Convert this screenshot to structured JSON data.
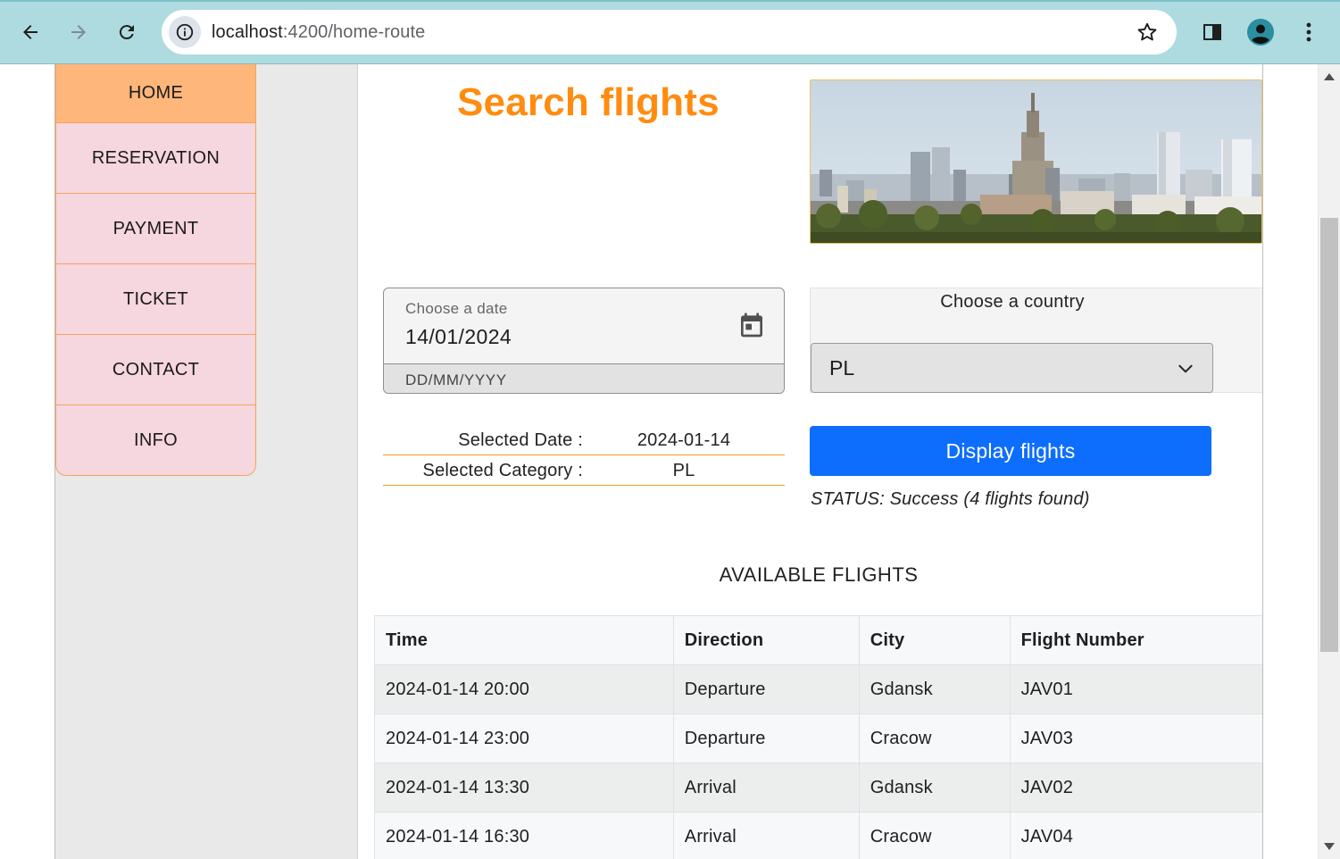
{
  "browser": {
    "url_host": "localhost",
    "url_path": ":4200/home-route"
  },
  "nav": {
    "items": [
      {
        "label": "HOME"
      },
      {
        "label": "RESERVATION"
      },
      {
        "label": "PAYMENT"
      },
      {
        "label": "TICKET"
      },
      {
        "label": "CONTACT"
      },
      {
        "label": "INFO"
      }
    ]
  },
  "page": {
    "title": "Search flights",
    "accent_color": "#ff8c10"
  },
  "date_field": {
    "label": "Choose a date",
    "value": "14/01/2024",
    "hint": "DD/MM/YYYY"
  },
  "country": {
    "label": "Choose a country",
    "selected": "PL"
  },
  "summary": {
    "date_label": "Selected Date :",
    "date_value": "2024-01-14",
    "category_label": "Selected Category :",
    "category_value": "PL"
  },
  "actions": {
    "display_label": "Display flights",
    "button_color": "#0d6efd"
  },
  "status": {
    "text": "STATUS: Success (4 flights found)"
  },
  "flights": {
    "heading": "AVAILABLE FLIGHTS",
    "columns": [
      "Time",
      "Direction",
      "City",
      "Flight Number"
    ],
    "rows": [
      [
        "2024-01-14 20:00",
        "Departure",
        "Gdansk",
        "JAV01"
      ],
      [
        "2024-01-14 23:00",
        "Departure",
        "Cracow",
        "JAV03"
      ],
      [
        "2024-01-14 13:30",
        "Arrival",
        "Gdansk",
        "JAV02"
      ],
      [
        "2024-01-14 16:30",
        "Arrival",
        "Cracow",
        "JAV04"
      ]
    ]
  }
}
